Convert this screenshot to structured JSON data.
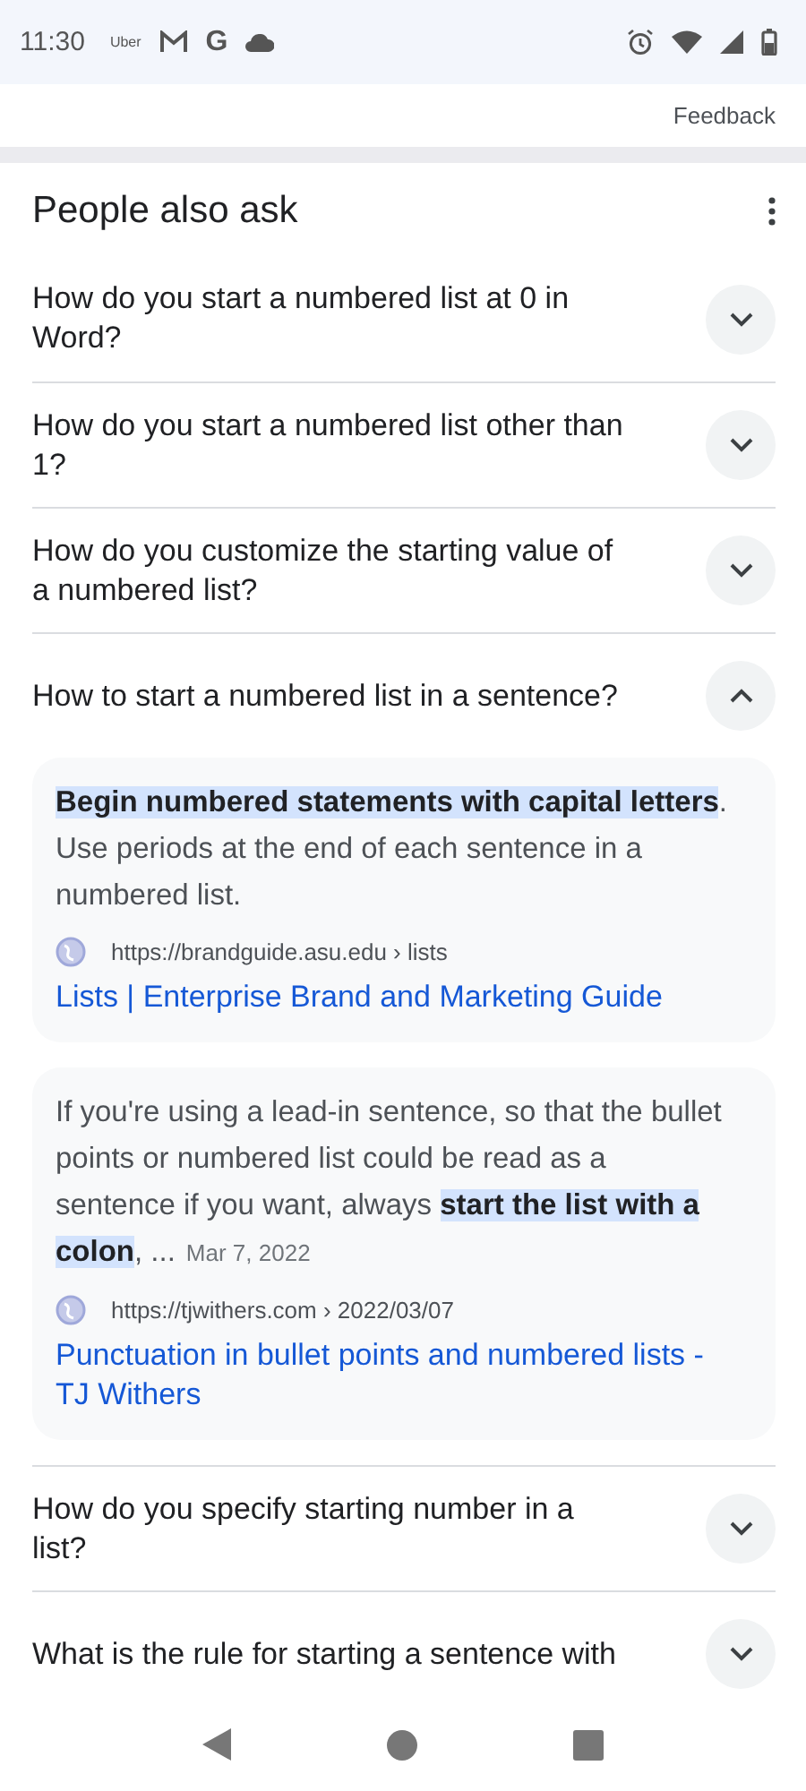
{
  "status_bar": {
    "time": "11:30",
    "uber_label": "Uber",
    "google_letter": "G"
  },
  "feedback": "Feedback",
  "people_also_ask": {
    "title": "People also ask",
    "questions": [
      {
        "text": "How do you start a numbered list at 0 in Word?",
        "expanded": false
      },
      {
        "text": "How do you start a numbered list other than 1?",
        "expanded": false
      },
      {
        "text": "How do you customize the starting value of a numbered list?",
        "expanded": false
      },
      {
        "text": "How to start a numbered list in a sentence?",
        "expanded": true,
        "answers": [
          {
            "snippet": "**Begin numbered statements with capital letters**. Use periods at the end of each sentence in a numbered list.",
            "url": "https://brandguide.asu.edu › lists",
            "title": "Lists | Enterprise Brand and Marketing Guide"
          },
          {
            "snippet": "If you're using a lead-in sentence, so that the bullet points or numbered list could be read as a sentence if you want, always **start the list with a colon**, ...",
            "date": "Mar 7, 2022",
            "url": "https://tjwithers.com › 2022/03/07",
            "title": "Punctuation in bullet points and numbered lists - TJ Withers"
          }
        ]
      },
      {
        "text": "How do you specify starting number in a list?",
        "expanded": false
      },
      {
        "text": "What is the rule for starting a sentence with",
        "expanded": false
      }
    ]
  }
}
